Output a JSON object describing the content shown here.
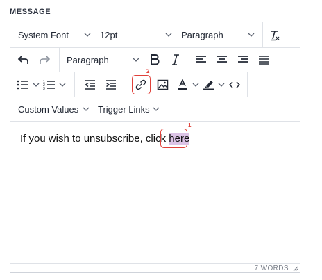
{
  "section_label": "MESSAGE",
  "toolbar": {
    "font_family": "System Font",
    "font_size": "12pt",
    "block_format": "Paragraph",
    "block_format_2": "Paragraph",
    "custom_values": "Custom Values",
    "trigger_links": "Trigger Links"
  },
  "content": {
    "text_before": "If you wish to unsubscribe, click ",
    "link_text": "here"
  },
  "annotations": {
    "badge_link_text": "1",
    "badge_link_button": "2"
  },
  "status": {
    "word_count": "7 WORDS"
  },
  "colors": {
    "highlight_border": "#e0413a",
    "link_background": "#dcc3e6"
  }
}
